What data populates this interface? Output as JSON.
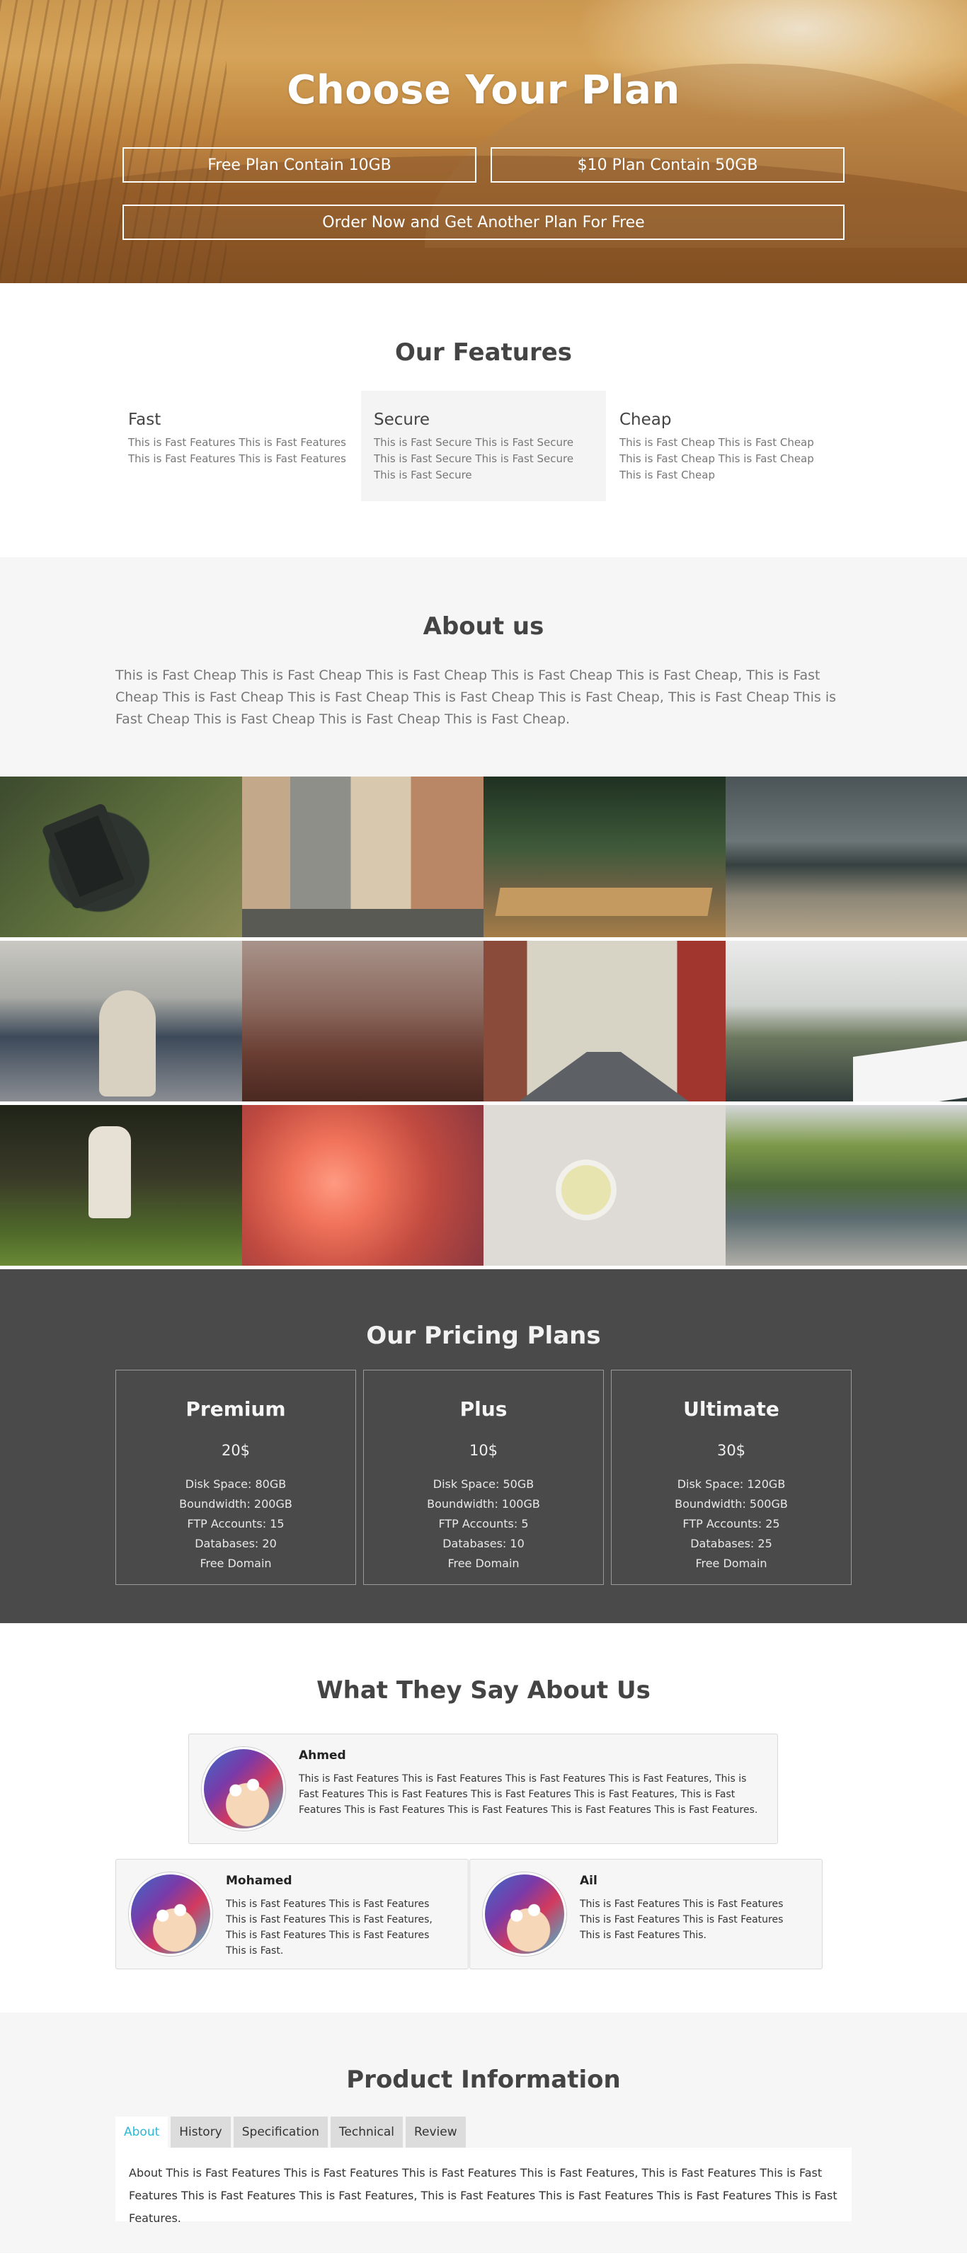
{
  "hero": {
    "title": "Choose Your Plan",
    "buttons": [
      "Free Plan Contain 10GB",
      "$10 Plan Contain 50GB",
      "Order Now and Get Another Plan For Free"
    ]
  },
  "features": {
    "title": "Our Features",
    "items": [
      {
        "title": "Fast",
        "text": "This is Fast Features This is Fast Features This is Fast Features This is Fast Features"
      },
      {
        "title": "Secure",
        "text": "This is Fast Secure This is Fast Secure This is Fast Secure This is Fast Secure This is Fast Secure"
      },
      {
        "title": "Cheap",
        "text": "This is Fast Cheap This is Fast Cheap This is Fast Cheap This is Fast Cheap This is Fast Cheap"
      }
    ]
  },
  "about": {
    "title": "About us",
    "text": "This is Fast Cheap This is Fast Cheap This is Fast Cheap This is Fast Cheap This is Fast Cheap, This is Fast Cheap This is Fast Cheap This is Fast Cheap This is Fast Cheap This is Fast Cheap, This is Fast Cheap This is Fast Cheap This is Fast Cheap This is Fast Cheap This is Fast Cheap."
  },
  "gallery": {
    "images": [
      "ereader-photo",
      "old-town-street-photo",
      "forest-boardwalk-photo",
      "seashore-photo",
      "city-street-photo",
      "autumn-path-photo",
      "alley-photo",
      "window-view-photo",
      "forest-girl-photo",
      "flower-photo",
      "tea-cup-photo",
      "river-bridge-photo"
    ]
  },
  "pricing": {
    "title": "Our Pricing Plans",
    "plans": [
      {
        "name": "Premium",
        "price": "20$",
        "features": [
          "Disk Space: 80GB",
          "Boundwidth: 200GB",
          "FTP Accounts: 15",
          "Databases: 20",
          "Free Domain"
        ]
      },
      {
        "name": "Plus",
        "price": "10$",
        "features": [
          "Disk Space: 50GB",
          "Boundwidth: 100GB",
          "FTP Accounts: 5",
          "Databases: 10",
          "Free Domain"
        ]
      },
      {
        "name": "Ultimate",
        "price": "30$",
        "features": [
          "Disk Space: 120GB",
          "Boundwidth: 500GB",
          "FTP Accounts: 25",
          "Databases: 25",
          "Free Domain"
        ]
      }
    ]
  },
  "testimonials": {
    "title": "What They Say About Us",
    "items": [
      {
        "name": "Ahmed",
        "text": "This is Fast Features This is Fast Features This is Fast Features This is Fast Features, This is Fast Features This is Fast Features This is Fast Features This is Fast Features, This is Fast Features This is Fast Features This is Fast Features This is Fast Features This is Fast Features."
      },
      {
        "name": "Mohamed",
        "text": "This is Fast Features This is Fast Features This is Fast Features This is Fast Features, This is Fast Features This is Fast Features This is Fast."
      },
      {
        "name": "Ail",
        "text": "This is Fast Features This is Fast Features This is Fast Features This is Fast Features This is Fast Features This."
      }
    ]
  },
  "product": {
    "title": "Product Information",
    "tabs": [
      "About",
      "History",
      "Specification",
      "Technical",
      "Review"
    ],
    "active_tab": "About",
    "content": "About This is Fast Features This is Fast Features This is Fast Features This is Fast Features, This is Fast Features This is Fast Features This is Fast Features This is Fast Features, This is Fast Features This is Fast Features This is Fast Features This is Fast Features."
  },
  "colors": {
    "accent": "#2bb7d6",
    "pricing_bg": "#4a4a4a",
    "section_alt_bg": "#f6f6f6"
  }
}
